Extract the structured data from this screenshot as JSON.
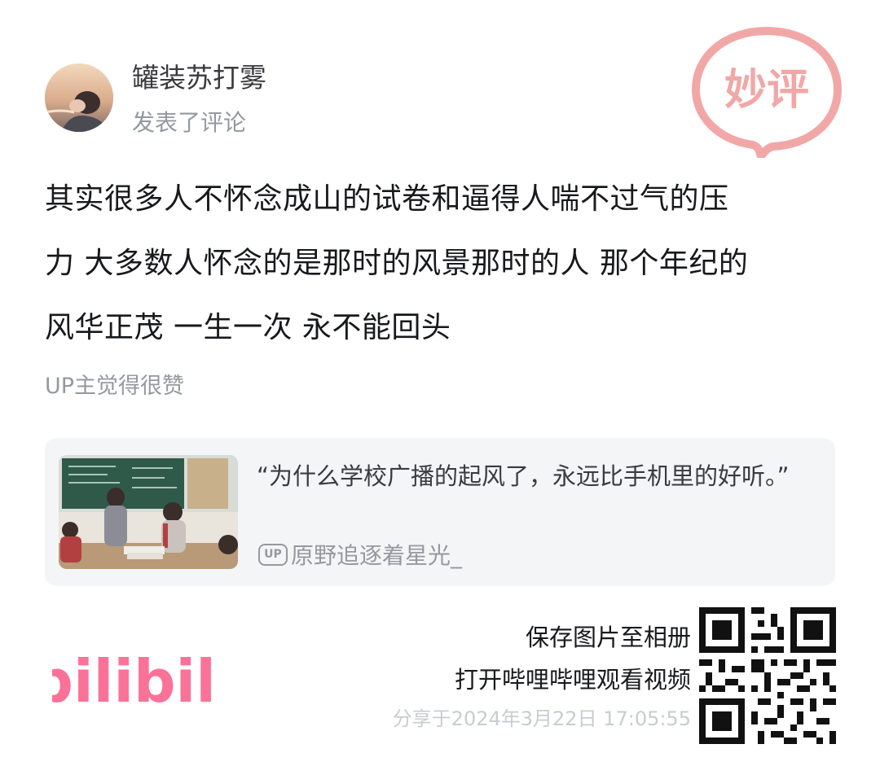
{
  "header": {
    "user_name": "罐装苏打雾",
    "action": "发表了评论",
    "badge_text": "妙评"
  },
  "comment": {
    "line1": "其实很多人不怀念成山的试卷和逼得人喘不过气的压",
    "line2": "力 大多数人怀念的是那时的风景那时的人 那个年纪的",
    "line3": "风华正茂 一生一次 永不能回头",
    "up_liked": "UP主觉得很赞"
  },
  "video_card": {
    "title": "“为什么学校广播的起风了，永远比手机里的好听。”",
    "up_tag": "UP",
    "up_name": "原野追逐着星光_"
  },
  "footer": {
    "logo_text": "bilibili",
    "save_label": "保存图片至相册",
    "open_label": "打开哔哩哔哩观看视频",
    "share_time": "分享于2024年3月22日 17:05:55"
  },
  "colors": {
    "badge_pink": "#f2a7a7",
    "logo_pink": "#fb7299",
    "text_primary": "#18191c",
    "text_secondary": "#9499a0",
    "card_bg": "#f4f5f7"
  }
}
